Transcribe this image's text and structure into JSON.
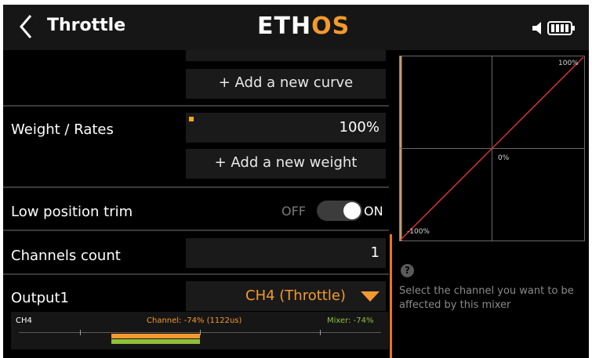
{
  "header": {
    "title": "Throttle",
    "logo_main": "ETH",
    "logo_accent": "OS",
    "icons": [
      "back-chevron-icon",
      "speaker-icon",
      "battery-icon"
    ]
  },
  "curve": {
    "add_label": "+ Add a new curve"
  },
  "weight": {
    "label": "Weight / Rates",
    "value": "100%",
    "add_label": "+ Add a new weight"
  },
  "trim": {
    "label": "Low position trim",
    "off_label": "OFF",
    "on_label": "ON",
    "state": "on"
  },
  "channels": {
    "label": "Channels count",
    "value": "1"
  },
  "output": {
    "label": "Output1",
    "value": "CH4 (Throttle)"
  },
  "monitor": {
    "channel_name": "CH4",
    "channel_text": "Channel: -74% (1122us)",
    "mixer_text": "Mixer: -74%",
    "channel_value": -74,
    "mixer_value": -74
  },
  "graph": {
    "label_top": "100%",
    "label_center": "0%",
    "label_bottom": "-100%"
  },
  "help": {
    "icon": "question-icon",
    "text": "Select the channel you want to be affected by this mixer"
  },
  "colors": {
    "accent": "#f29a2e",
    "mixer": "#8fc03a",
    "curve_line": "#d9333b",
    "scroll": "#e8741c"
  }
}
